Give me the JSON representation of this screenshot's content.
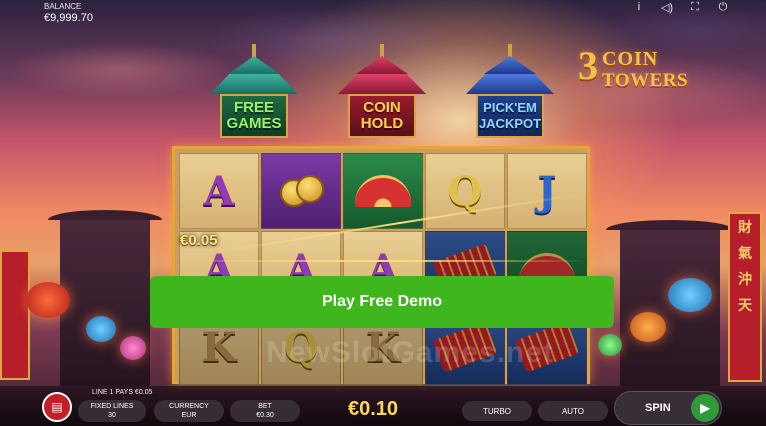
{
  "balance": {
    "label": "BALANCE",
    "value": "€9,999.70"
  },
  "top_icons": [
    "info-icon",
    "sound-icon",
    "fullscreen-icon",
    "power-icon"
  ],
  "top_icon_glyphs": {
    "info": "i",
    "sound": "◁)",
    "fullscreen": "⛶",
    "power": "⏻"
  },
  "logo": {
    "number": "3",
    "word1": "COIN",
    "word2": "TOWERS"
  },
  "towers": [
    {
      "line1": "FREE",
      "line2": "GAMES",
      "color": "#9bf06a"
    },
    {
      "line1": "COIN",
      "line2": "HOLD",
      "color": "#ffd24a"
    },
    {
      "line1": "PICK'EM",
      "line2": "JACKPOT",
      "color": "#8fd6ff"
    }
  ],
  "reels": {
    "rows": [
      [
        "A",
        "coins",
        "fan",
        "Q",
        "J"
      ],
      [
        "A",
        "A",
        "A",
        "firecracker",
        "fan"
      ],
      [
        "K",
        "Q",
        "K",
        "firecracker",
        "firecracker"
      ]
    ]
  },
  "win_line_value": "€0.05",
  "demo_button": "Play Free Demo",
  "watermark": "NewSlotGames.net",
  "bottom": {
    "line_pays": "LINE 1 PAYS €0.05",
    "fixed_lines_label": "FIXED LINES",
    "fixed_lines_value": "30",
    "currency_label": "CURRENCY",
    "currency_value": "EUR",
    "bet_label": "BET",
    "bet_value": "€0.30",
    "win": "€0.10",
    "turbo": "TURBO",
    "auto": "AUTO",
    "spin": "SPIN"
  },
  "colors": {
    "accent_green": "#3fb61e",
    "frame_gold": "#e6a53a",
    "win_gold": "#ffd65a"
  }
}
